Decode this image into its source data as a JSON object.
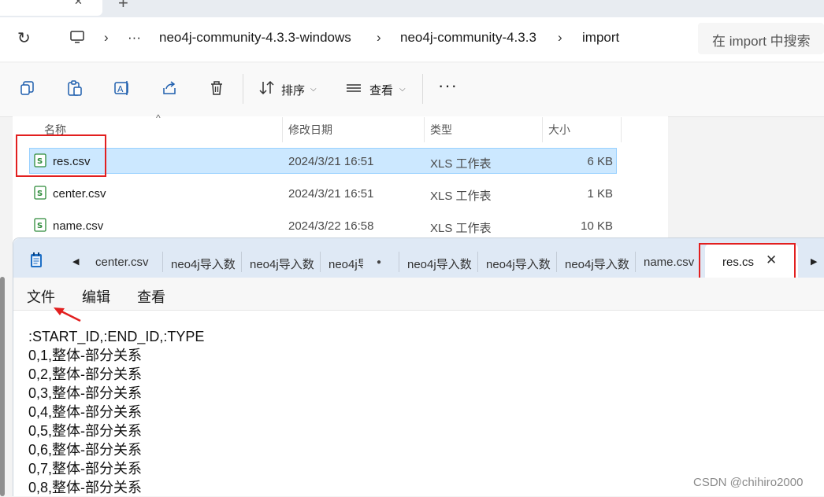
{
  "explorer": {
    "tab_close": "✕",
    "tab_add": "+",
    "breadcrumbs": [
      "neo4j-community-4.3.3-windows",
      "neo4j-community-4.3.3",
      "import"
    ],
    "breadcrumb_more": "···",
    "search_placeholder": "在 import 中搜索",
    "toolbar": {
      "sort_label": "排序",
      "view_label": "查看",
      "more": "···"
    },
    "columns": [
      "名称",
      "修改日期",
      "类型",
      "大小"
    ],
    "files": [
      {
        "name": "res.csv",
        "modified": "2024/3/21 16:51",
        "type": "XLS 工作表",
        "size": "6 KB",
        "selected": true
      },
      {
        "name": "center.csv",
        "modified": "2024/3/21 16:51",
        "type": "XLS 工作表",
        "size": "1 KB",
        "selected": false
      },
      {
        "name": "name.csv",
        "modified": "2024/3/22 16:58",
        "type": "XLS 工作表",
        "size": "10 KB",
        "selected": false
      }
    ]
  },
  "notepad": {
    "tabs": [
      "center.csv",
      "neo4j导入数",
      "neo4j导入数",
      "neo4j导",
      "neo4j导入数",
      "neo4j导入数",
      "neo4j导入数",
      "name.csv"
    ],
    "active_tab": "res.csv",
    "active_tab_close": "✕",
    "nav_prev": "◀",
    "nav_next": "▶",
    "menu": [
      "文件",
      "编辑",
      "查看"
    ],
    "content_lines": [
      ":START_ID,:END_ID,:TYPE",
      "0,1,整体-部分关系",
      "0,2,整体-部分关系",
      "0,3,整体-部分关系",
      "0,4,整体-部分关系",
      "0,5,整体-部分关系",
      "0,6,整体-部分关系",
      "0,7,整体-部分关系",
      "0,8,整体-部分关系"
    ]
  },
  "watermark": "CSDN @chihiro2000",
  "colors": {
    "highlight": "#cce8ff",
    "annotation_red": "#e21f1f",
    "csv_icon_green": "#2e8b3a"
  }
}
